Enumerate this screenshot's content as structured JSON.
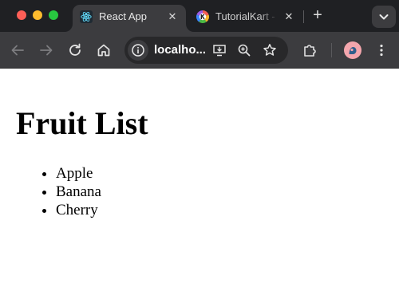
{
  "browser": {
    "tabs": [
      {
        "title": "React App",
        "active": true,
        "favicon": "react-logo-icon",
        "close": "✕"
      },
      {
        "title": "TutorialKart -",
        "active": false,
        "favicon": "tutorialkart-logo-icon",
        "close": "✕"
      }
    ],
    "new_tab_label": "+",
    "address_bar": {
      "url": "localho...",
      "icons": [
        "info-icon",
        "install-app-icon",
        "zoom-icon",
        "bookmark-star-icon"
      ]
    },
    "toolbar_icons": [
      "back-arrow-icon",
      "forward-arrow-icon",
      "reload-icon",
      "home-icon",
      "extensions-puzzle-icon",
      "profile-avatar",
      "kebab-menu-icon"
    ],
    "colors": {
      "tab_strip": "#1f2023",
      "toolbar": "#3c3c3f",
      "omnibox": "#28282a",
      "close_dot": "#fe5f57",
      "minimize_dot": "#febc2e",
      "maximize_dot": "#28c840",
      "avatar": "#f4a6ad"
    }
  },
  "page": {
    "heading": "Fruit List",
    "fruits": [
      "Apple",
      "Banana",
      "Cherry"
    ]
  }
}
